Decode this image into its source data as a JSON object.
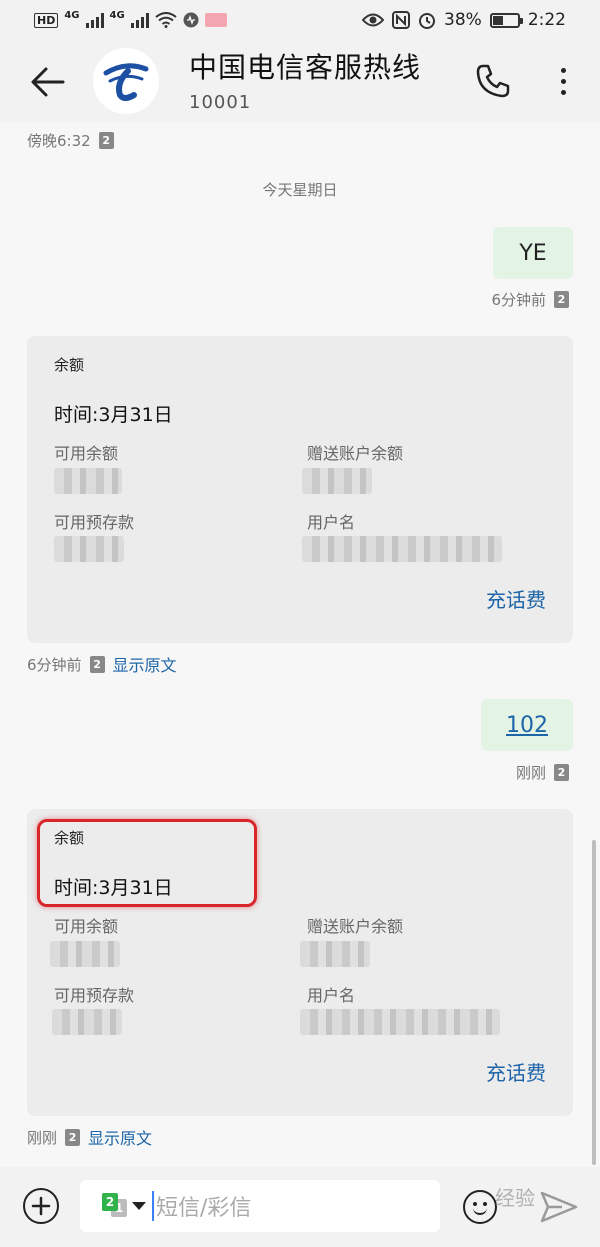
{
  "status_bar": {
    "hd": "HD",
    "net1": "4G",
    "net2": "4G",
    "battery": "38%",
    "time": "2:22",
    "icons": [
      "hd-icon",
      "signal-icon",
      "wifi-icon",
      "eye-icon",
      "nfc-icon",
      "alarm-icon",
      "battery-icon"
    ]
  },
  "header": {
    "title": "中国电信客服热线",
    "number": "10001"
  },
  "messages": {
    "top_meta": "傍晚6:32",
    "sim": "2",
    "date_separator": "今天星期日",
    "out1": {
      "text": "YE",
      "meta": "6分钟前"
    },
    "card1": {
      "heading": "余额",
      "time": "时间:3月31日",
      "labels": [
        "可用余额",
        "赠送账户余额",
        "可用预存款",
        "用户名"
      ],
      "recharge": "充话费",
      "meta": "6分钟前",
      "show_original": "显示原文"
    },
    "out2": {
      "text": "102",
      "meta": "刚刚"
    },
    "card2": {
      "heading": "余额",
      "time": "时间:3月31日",
      "labels": [
        "可用余额",
        "赠送账户余额",
        "可用预存款",
        "用户名"
      ],
      "recharge": "充话费",
      "meta": "刚刚",
      "show_original": "显示原文"
    }
  },
  "input_bar": {
    "sim_front": "2",
    "sim_back": "1",
    "placeholder": "短信/彩信",
    "watermark": "经验"
  },
  "colors": {
    "accent": "#1d64a8",
    "outgoing_bubble": "#e3f4e5",
    "card_bg": "#ececec",
    "highlight": "#d8262b"
  }
}
